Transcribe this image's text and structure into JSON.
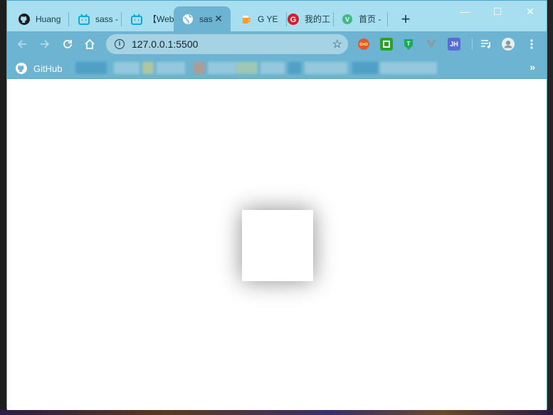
{
  "browser": {
    "tabs": [
      {
        "title": "Huang",
        "icon": "github-icon",
        "active": false
      },
      {
        "title": "sass -",
        "icon": "bilibili-icon",
        "active": false
      },
      {
        "title": "【Web",
        "icon": "bilibili-icon",
        "active": false
      },
      {
        "title": "sas",
        "icon": "globe-icon",
        "active": true
      },
      {
        "title": "G   YE",
        "icon": "beer-icon",
        "active": false
      },
      {
        "title": "我的工",
        "icon": "g-icon",
        "active": false
      },
      {
        "title": "首页 -",
        "icon": "vue-icon",
        "active": false
      }
    ],
    "new_tab_symbol": "+",
    "window_controls": {
      "minimize": "—",
      "maximize": "☐",
      "close": "✕"
    },
    "address_bar": {
      "url": "127.0.0.1:5500"
    },
    "extensions": [
      "infinity-icon",
      "green-square-icon",
      "tampermonkey-icon",
      "vue-devtools-icon",
      "jh-icon"
    ],
    "extension_jh_label": "JH",
    "bookmarks": [
      {
        "label": "GitHub",
        "icon": "github-icon"
      }
    ],
    "bookmarks_more": "»"
  },
  "colors": {
    "tabstrip": "#a7dff0",
    "toolbar": "#6cb4d2",
    "active_tab": "#6cb4d2",
    "page_background": "#ffffff"
  }
}
